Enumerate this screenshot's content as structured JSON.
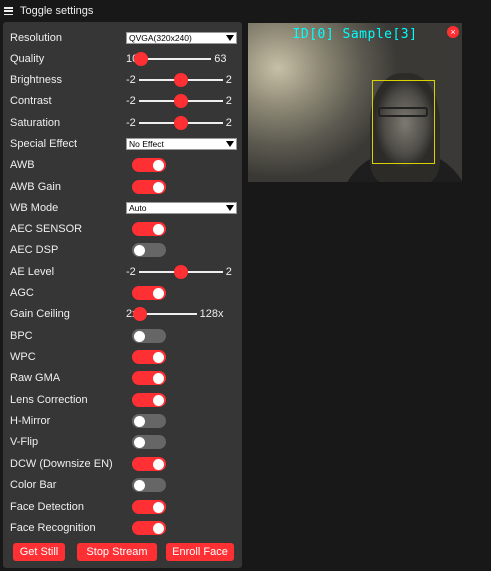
{
  "header": {
    "title": "Toggle settings"
  },
  "controls": {
    "resolution": {
      "label": "Resolution",
      "value": "QVGA(320x240)"
    },
    "quality": {
      "label": "Quality",
      "min": "10",
      "max": "63",
      "value": 10
    },
    "brightness": {
      "label": "Brightness",
      "min": "-2",
      "max": "2",
      "value": 0
    },
    "contrast": {
      "label": "Contrast",
      "min": "-2",
      "max": "2",
      "value": 0
    },
    "saturation": {
      "label": "Saturation",
      "min": "-2",
      "max": "2",
      "value": 0
    },
    "special_effect": {
      "label": "Special Effect",
      "value": "No Effect"
    },
    "awb": {
      "label": "AWB",
      "on": true
    },
    "awb_gain": {
      "label": "AWB Gain",
      "on": true
    },
    "wb_mode": {
      "label": "WB Mode",
      "value": "Auto"
    },
    "aec_sensor": {
      "label": "AEC SENSOR",
      "on": true
    },
    "aec_dsp": {
      "label": "AEC DSP",
      "on": false
    },
    "ae_level": {
      "label": "AE Level",
      "min": "-2",
      "max": "2",
      "value": 0
    },
    "agc": {
      "label": "AGC",
      "on": true
    },
    "gain_ceiling": {
      "label": "Gain Ceiling",
      "min": "2x",
      "max": "128x",
      "value": 0
    },
    "bpc": {
      "label": "BPC",
      "on": false
    },
    "wpc": {
      "label": "WPC",
      "on": true
    },
    "raw_gma": {
      "label": "Raw GMA",
      "on": true
    },
    "lens_correction": {
      "label": "Lens Correction",
      "on": true
    },
    "h_mirror": {
      "label": "H-Mirror",
      "on": false
    },
    "v_flip": {
      "label": "V-Flip",
      "on": false
    },
    "dcw": {
      "label": "DCW (Downsize EN)",
      "on": true
    },
    "color_bar": {
      "label": "Color Bar",
      "on": false
    },
    "face_detection": {
      "label": "Face Detection",
      "on": true
    },
    "face_recognition": {
      "label": "Face Recognition",
      "on": true
    }
  },
  "buttons": {
    "get_still": "Get Still",
    "stop_stream": "Stop Stream",
    "enroll_face": "Enroll Face"
  },
  "stream": {
    "overlay_text": "ID[0] Sample[3]",
    "close_glyph": "×"
  },
  "colors": {
    "accent": "#ff3034",
    "panel": "#363636",
    "background": "#181818",
    "overlay_text": "#00ffff",
    "face_box": "#d8d200"
  }
}
